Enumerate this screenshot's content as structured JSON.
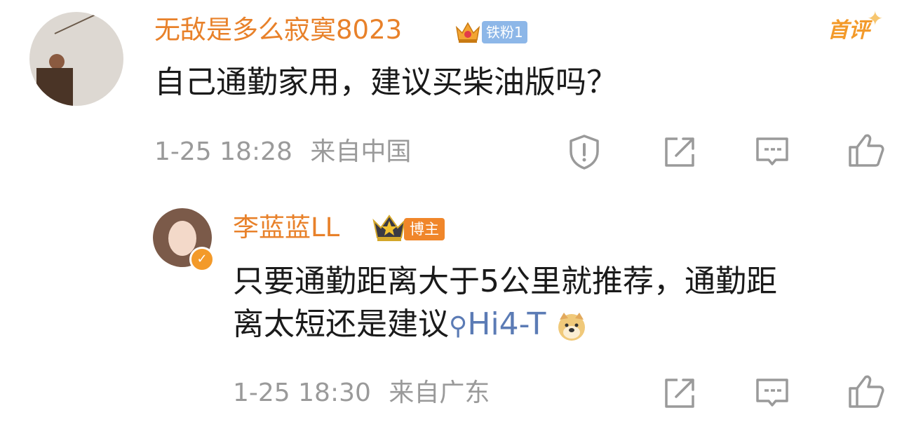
{
  "comment": {
    "username": "无敌是多么寂寞8023",
    "fan_badge": "铁粉1",
    "first_label": "首评",
    "text": "自己通勤家用，建议买柴油版吗？",
    "time": "1-25 18:28",
    "location": "来自中国",
    "actions": [
      "report-icon",
      "share-icon",
      "comment-icon",
      "like-icon"
    ]
  },
  "reply": {
    "username": "李蓝蓝LL",
    "role_badge": "博主",
    "line1": "只要通勤距离大于5公里就推荐，通勤距",
    "line2_prefix": "离太短还是建议",
    "link_text": "Hi4-T",
    "time": "1-25 18:30",
    "location": "来自广东",
    "actions": [
      "share-icon",
      "comment-icon",
      "like-icon"
    ]
  },
  "colors": {
    "username": "#e8812a",
    "meta": "#9a9a9a",
    "link": "#5b7bb5",
    "fan_badge": "#8db7e8",
    "blogger_badge": "#f0862a"
  }
}
